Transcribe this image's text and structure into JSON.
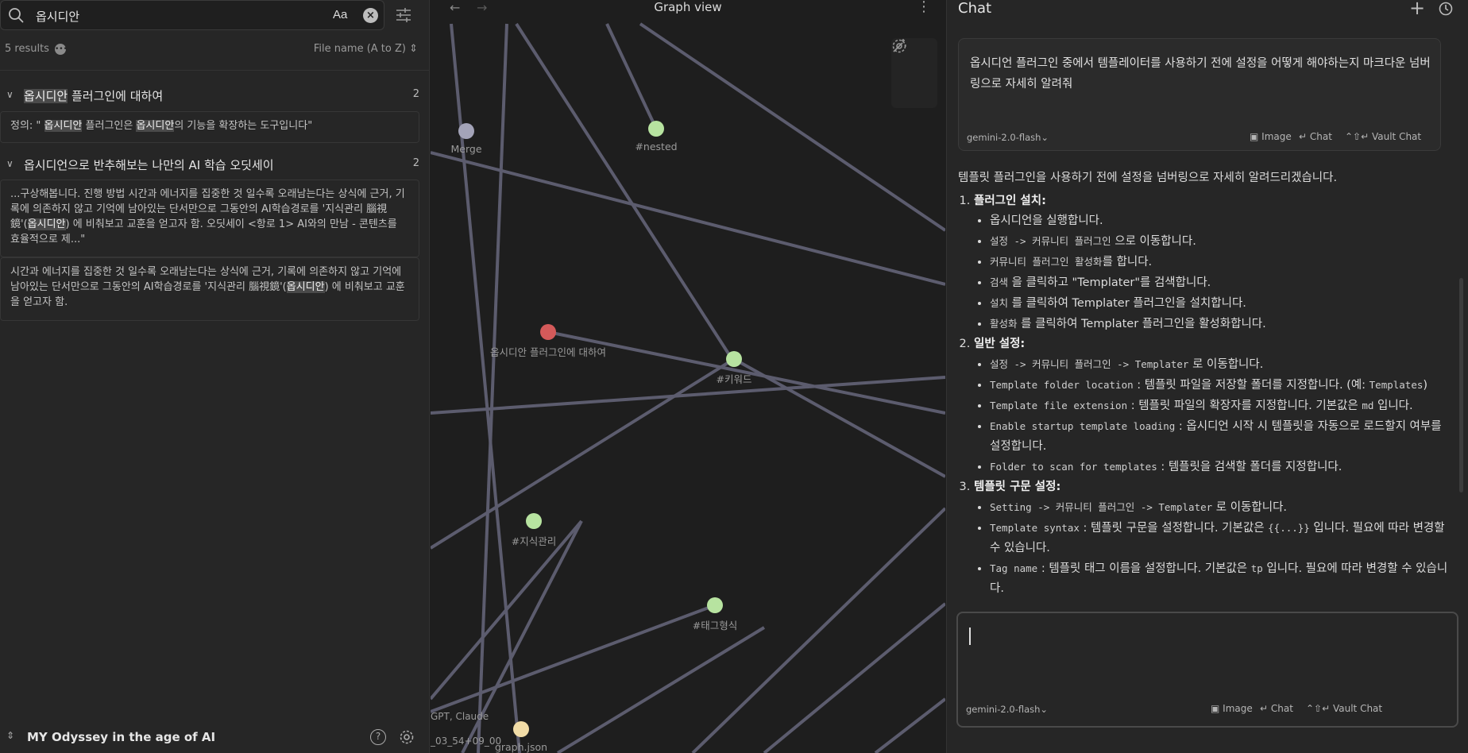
{
  "search": {
    "query": "옵시디안",
    "case_label": "Aa",
    "results_count": "5 results",
    "sort_label": "File name (A to Z)"
  },
  "results": [
    {
      "title_parts": [
        "옵시디안",
        " 플러그인에 대하여"
      ],
      "count": "2",
      "snippets": [
        [
          "정의: \" ",
          "옵시디안",
          " 플러그인은 ",
          "옵시디안",
          "의 기능을 확장하는 도구입니다\""
        ]
      ]
    },
    {
      "title_parts": [
        "",
        "옵시디언으로 반추해보는 나만의 AI 학습 오딧세이"
      ],
      "count": "2",
      "snippets": [
        [
          "...구상해봅니다. 진행 방법 시간과 에너지를 집중한 것 일수록 오래남는다는 상식에 근거, 기록에 의존하지 않고 기억에 남아있는 단서만으로 그동안의 AI학습경로를 '지식관리 腦視鏡'(",
          "옵시디안",
          ") 에 비춰보고 교훈을 얻고자 함. 오딧세이 <항로 1> AI와의 만남 - 콘텐츠를 효율적으로 제...\""
        ],
        [
          "시간과 에너지를 집중한 것 일수록 오래남는다는 상식에 근거, 기록에 의존하지 않고 기억에 남아있는 단서만으로 그동안의 AI학습경로를 '지식관리 腦視鏡'(",
          "옵시디안",
          ") 에 비춰보고 교훈을 얻고자 함."
        ]
      ]
    }
  ],
  "vault": {
    "name": "MY Odyssey in the age of AI"
  },
  "graph": {
    "title": "Graph view",
    "nodes": [
      {
        "label": "Merge",
        "color": "#a3a3b8"
      },
      {
        "label": "#nested",
        "color": "#b7e3a0"
      },
      {
        "label": "옵시디안 플러그인에 대하여",
        "color": "#d45a5a"
      },
      {
        "label": "#키워드",
        "color": "#b7e3a0"
      },
      {
        "label": "#지식관리",
        "color": "#b7e3a0"
      },
      {
        "label": "#태그형식",
        "color": "#b7e3a0"
      },
      {
        "label": "graph.json",
        "color": "#f1dca7"
      }
    ],
    "corner_texts": [
      "GPT, Claude",
      "_03_54+09_00"
    ]
  },
  "chat": {
    "title": "Chat",
    "user_message": "옵시디언 플러그인 중에서 템플레이터를 사용하기 전에 설정을 어떻게 해야하는지 마크다운 넘버링으로 자세히 알려줘",
    "model": "gemini-2.0-flash",
    "actions": {
      "image": "Image",
      "chat": "Chat",
      "vault_chat": "Vault Chat"
    },
    "reply_intro": "템플릿 플러그인을 사용하기 전에 설정을 넘버링으로 자세히 알려드리겠습니다.",
    "reply_sections": [
      {
        "heading": "플러그인 설치:",
        "items": [
          [
            {
              "t": "옵시디언을 실행합니다."
            }
          ],
          [
            {
              "c": "설정 -> 커뮤니티 플러그인"
            },
            {
              "t": " 으로 이동합니다."
            }
          ],
          [
            {
              "c": "커뮤니티 플러그인 활성화"
            },
            {
              "t": "를 합니다."
            }
          ],
          [
            {
              "c": "검색"
            },
            {
              "t": " 을 클릭하고 \"Templater\"를 검색합니다."
            }
          ],
          [
            {
              "c": "설치"
            },
            {
              "t": " 를 클릭하여 Templater 플러그인을 설치합니다."
            }
          ],
          [
            {
              "c": "활성화"
            },
            {
              "t": " 를 클릭하여 Templater 플러그인을 활성화합니다."
            }
          ]
        ]
      },
      {
        "heading": "일반 설정:",
        "items": [
          [
            {
              "c": "설정 -> 커뮤니티 플러그인 -> Templater"
            },
            {
              "t": " 로 이동합니다."
            }
          ],
          [
            {
              "c": "Template folder location"
            },
            {
              "t": " : 템플릿 파일을 저장할 폴더를 지정합니다. (예: "
            },
            {
              "c": "Templates"
            },
            {
              "t": ")"
            }
          ],
          [
            {
              "c": "Template file extension"
            },
            {
              "t": " : 템플릿 파일의 확장자를 지정합니다. 기본값은 "
            },
            {
              "c": "md"
            },
            {
              "t": " 입니다."
            }
          ],
          [
            {
              "c": "Enable startup template loading"
            },
            {
              "t": " : 옵시디언 시작 시 템플릿을 자동으로 로드할지 여부를 설정합니다."
            }
          ],
          [
            {
              "c": "Folder to scan for templates"
            },
            {
              "t": " : 템플릿을 검색할 폴더를 지정합니다."
            }
          ]
        ]
      },
      {
        "heading": "템플릿 구문 설정:",
        "items": [
          [
            {
              "c": "Setting -> 커뮤니티 플러그인 -> Templater"
            },
            {
              "t": " 로 이동합니다."
            }
          ],
          [
            {
              "c": "Template syntax"
            },
            {
              "t": " : 템플릿 구문을 설정합니다. 기본값은 "
            },
            {
              "c": "{{...}}"
            },
            {
              "t": " 입니다. 필요에 따라 변경할 수 있습니다."
            }
          ],
          [
            {
              "c": "Tag name"
            },
            {
              "t": " : 템플릿 태그 이름을 설정합니다. 기본값은 "
            },
            {
              "c": "tp"
            },
            {
              "t": " 입니다. 필요에 따라 변경할 수 있습니다."
            }
          ]
        ]
      }
    ]
  }
}
